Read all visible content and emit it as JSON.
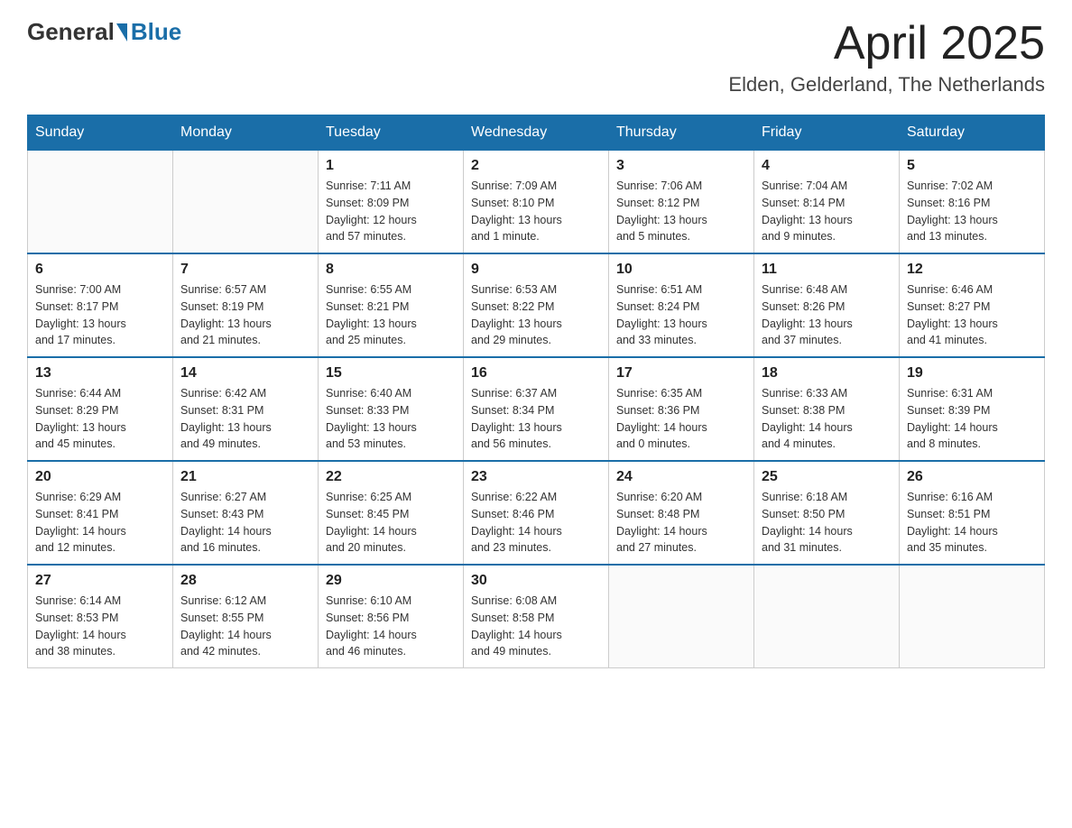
{
  "header": {
    "logo": {
      "general": "General",
      "blue": "Blue"
    },
    "title": "April 2025",
    "subtitle": "Elden, Gelderland, The Netherlands"
  },
  "weekdays": [
    "Sunday",
    "Monday",
    "Tuesday",
    "Wednesday",
    "Thursday",
    "Friday",
    "Saturday"
  ],
  "weeks": [
    [
      {
        "day": "",
        "info": ""
      },
      {
        "day": "",
        "info": ""
      },
      {
        "day": "1",
        "info": "Sunrise: 7:11 AM\nSunset: 8:09 PM\nDaylight: 12 hours\nand 57 minutes."
      },
      {
        "day": "2",
        "info": "Sunrise: 7:09 AM\nSunset: 8:10 PM\nDaylight: 13 hours\nand 1 minute."
      },
      {
        "day": "3",
        "info": "Sunrise: 7:06 AM\nSunset: 8:12 PM\nDaylight: 13 hours\nand 5 minutes."
      },
      {
        "day": "4",
        "info": "Sunrise: 7:04 AM\nSunset: 8:14 PM\nDaylight: 13 hours\nand 9 minutes."
      },
      {
        "day": "5",
        "info": "Sunrise: 7:02 AM\nSunset: 8:16 PM\nDaylight: 13 hours\nand 13 minutes."
      }
    ],
    [
      {
        "day": "6",
        "info": "Sunrise: 7:00 AM\nSunset: 8:17 PM\nDaylight: 13 hours\nand 17 minutes."
      },
      {
        "day": "7",
        "info": "Sunrise: 6:57 AM\nSunset: 8:19 PM\nDaylight: 13 hours\nand 21 minutes."
      },
      {
        "day": "8",
        "info": "Sunrise: 6:55 AM\nSunset: 8:21 PM\nDaylight: 13 hours\nand 25 minutes."
      },
      {
        "day": "9",
        "info": "Sunrise: 6:53 AM\nSunset: 8:22 PM\nDaylight: 13 hours\nand 29 minutes."
      },
      {
        "day": "10",
        "info": "Sunrise: 6:51 AM\nSunset: 8:24 PM\nDaylight: 13 hours\nand 33 minutes."
      },
      {
        "day": "11",
        "info": "Sunrise: 6:48 AM\nSunset: 8:26 PM\nDaylight: 13 hours\nand 37 minutes."
      },
      {
        "day": "12",
        "info": "Sunrise: 6:46 AM\nSunset: 8:27 PM\nDaylight: 13 hours\nand 41 minutes."
      }
    ],
    [
      {
        "day": "13",
        "info": "Sunrise: 6:44 AM\nSunset: 8:29 PM\nDaylight: 13 hours\nand 45 minutes."
      },
      {
        "day": "14",
        "info": "Sunrise: 6:42 AM\nSunset: 8:31 PM\nDaylight: 13 hours\nand 49 minutes."
      },
      {
        "day": "15",
        "info": "Sunrise: 6:40 AM\nSunset: 8:33 PM\nDaylight: 13 hours\nand 53 minutes."
      },
      {
        "day": "16",
        "info": "Sunrise: 6:37 AM\nSunset: 8:34 PM\nDaylight: 13 hours\nand 56 minutes."
      },
      {
        "day": "17",
        "info": "Sunrise: 6:35 AM\nSunset: 8:36 PM\nDaylight: 14 hours\nand 0 minutes."
      },
      {
        "day": "18",
        "info": "Sunrise: 6:33 AM\nSunset: 8:38 PM\nDaylight: 14 hours\nand 4 minutes."
      },
      {
        "day": "19",
        "info": "Sunrise: 6:31 AM\nSunset: 8:39 PM\nDaylight: 14 hours\nand 8 minutes."
      }
    ],
    [
      {
        "day": "20",
        "info": "Sunrise: 6:29 AM\nSunset: 8:41 PM\nDaylight: 14 hours\nand 12 minutes."
      },
      {
        "day": "21",
        "info": "Sunrise: 6:27 AM\nSunset: 8:43 PM\nDaylight: 14 hours\nand 16 minutes."
      },
      {
        "day": "22",
        "info": "Sunrise: 6:25 AM\nSunset: 8:45 PM\nDaylight: 14 hours\nand 20 minutes."
      },
      {
        "day": "23",
        "info": "Sunrise: 6:22 AM\nSunset: 8:46 PM\nDaylight: 14 hours\nand 23 minutes."
      },
      {
        "day": "24",
        "info": "Sunrise: 6:20 AM\nSunset: 8:48 PM\nDaylight: 14 hours\nand 27 minutes."
      },
      {
        "day": "25",
        "info": "Sunrise: 6:18 AM\nSunset: 8:50 PM\nDaylight: 14 hours\nand 31 minutes."
      },
      {
        "day": "26",
        "info": "Sunrise: 6:16 AM\nSunset: 8:51 PM\nDaylight: 14 hours\nand 35 minutes."
      }
    ],
    [
      {
        "day": "27",
        "info": "Sunrise: 6:14 AM\nSunset: 8:53 PM\nDaylight: 14 hours\nand 38 minutes."
      },
      {
        "day": "28",
        "info": "Sunrise: 6:12 AM\nSunset: 8:55 PM\nDaylight: 14 hours\nand 42 minutes."
      },
      {
        "day": "29",
        "info": "Sunrise: 6:10 AM\nSunset: 8:56 PM\nDaylight: 14 hours\nand 46 minutes."
      },
      {
        "day": "30",
        "info": "Sunrise: 6:08 AM\nSunset: 8:58 PM\nDaylight: 14 hours\nand 49 minutes."
      },
      {
        "day": "",
        "info": ""
      },
      {
        "day": "",
        "info": ""
      },
      {
        "day": "",
        "info": ""
      }
    ]
  ]
}
